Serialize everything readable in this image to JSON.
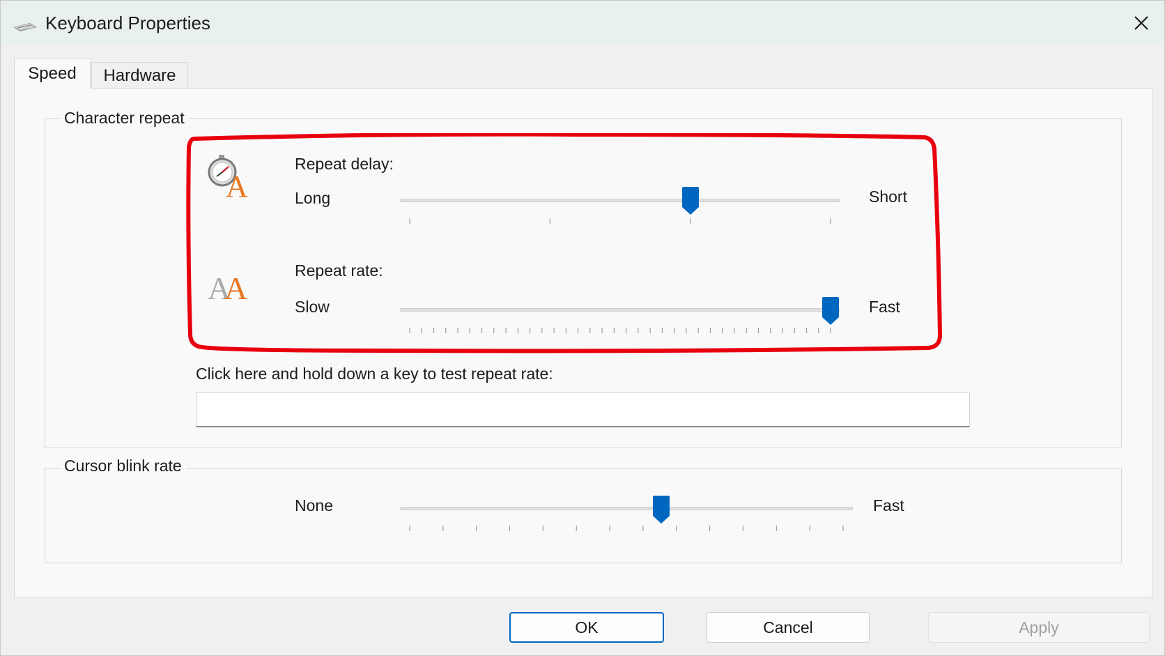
{
  "window": {
    "title": "Keyboard Properties"
  },
  "tabs": [
    {
      "label": "Speed",
      "selected": true
    },
    {
      "label": "Hardware",
      "selected": false
    }
  ],
  "character_repeat": {
    "legend": "Character repeat",
    "repeat_delay": {
      "label": "Repeat delay:",
      "min_label": "Long",
      "max_label": "Short",
      "icon": "stopwatch-letter-a-icon",
      "ticks": 4,
      "value": 2,
      "max": 3
    },
    "repeat_rate": {
      "label": "Repeat rate:",
      "min_label": "Slow",
      "max_label": "Fast",
      "icon": "double-letter-a-icon",
      "ticks": 36,
      "value": 31,
      "max": 31
    },
    "test_label": "Click here and hold down a key to test repeat rate:",
    "test_value": ""
  },
  "cursor_blink": {
    "legend": "Cursor blink rate",
    "min_label": "None",
    "max_label": "Fast",
    "ticks": 14,
    "value": 0.58
  },
  "buttons": {
    "ok": "OK",
    "cancel": "Cancel",
    "apply": "Apply"
  },
  "colors": {
    "accent": "#0067c0",
    "annotation": "#e8000f",
    "letter_orange": "#e87722"
  }
}
